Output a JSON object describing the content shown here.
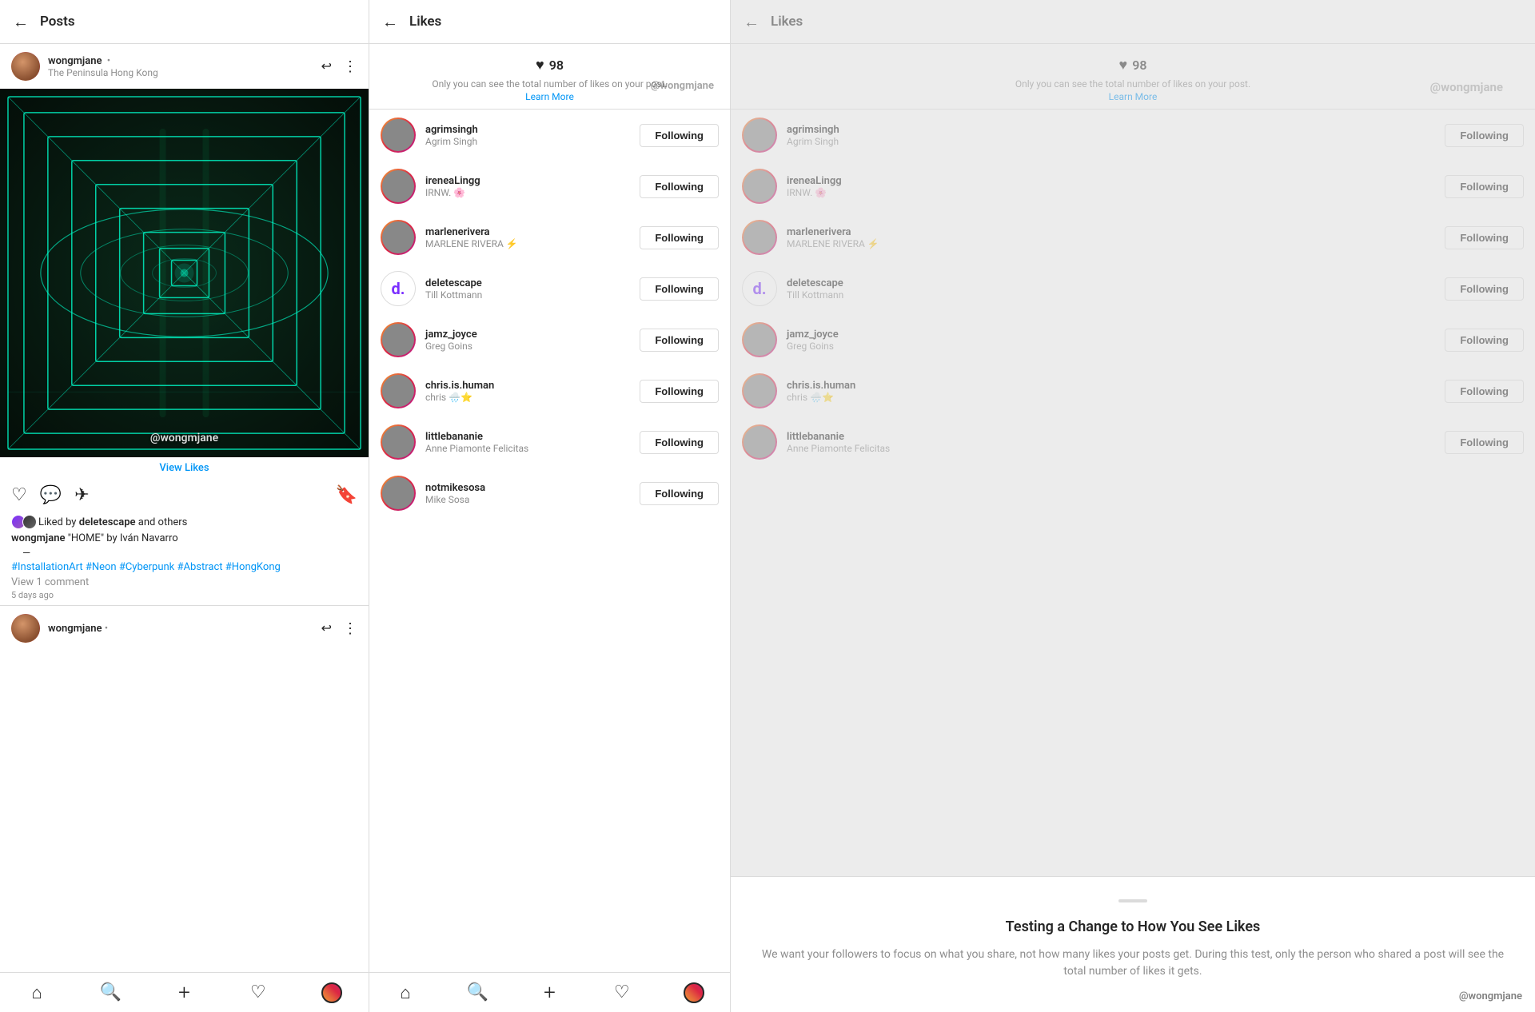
{
  "panel1": {
    "header": {
      "back_label": "←",
      "title": "Posts"
    },
    "post": {
      "username": "wongmjane",
      "dot": "•",
      "location": "The Peninsula Hong Kong",
      "image_watermark": "@wongmjane",
      "view_likes": "View Likes",
      "liked_by_text": "Liked by",
      "liked_by_bold": "deletescape",
      "liked_by_rest": "and others",
      "caption_user": "wongmjane",
      "caption_text": "\"HOME\" by Iván Navarro",
      "separator": "—",
      "hashtags": "#InstallationArt #Neon #Cyberpunk #Abstract #HongKong",
      "comments": "View 1 comment",
      "time": "5 days ago"
    },
    "nav": {
      "home": "⌂",
      "search": "🔍",
      "add": "+",
      "heart": "♡",
      "profile": ""
    }
  },
  "panel2": {
    "header": {
      "back_label": "←",
      "title": "Likes"
    },
    "likes_count": "98",
    "likes_note": "Only you can see the total number of likes on your post.",
    "learn_more": "Learn More",
    "watermark": "@wongmjane",
    "users": [
      {
        "handle": "agrimsingh",
        "fullname": "Agrim Singh",
        "following": "Following",
        "avatar_class": "av-brown"
      },
      {
        "handle": "ireneaLingg",
        "fullname": "IRNW. 🌸",
        "following": "Following",
        "avatar_class": "av-dark"
      },
      {
        "handle": "marlenerivera",
        "fullname": "MARLENE RIVERA ⚡",
        "following": "Following",
        "avatar_class": "av-photo3"
      },
      {
        "handle": "deletescape",
        "fullname": "Till Kottmann",
        "following": "Following",
        "avatar_class": "av-purple",
        "is_logo": true
      },
      {
        "handle": "jamz_joyce",
        "fullname": "Greg Goins",
        "following": "Following",
        "avatar_class": "av-photo4"
      },
      {
        "handle": "chris.is.human",
        "fullname": "chris 🌧️⭐",
        "following": "Following",
        "avatar_class": "av-photo6"
      },
      {
        "handle": "littlebananie",
        "fullname": "Anne Piamonte Felicitas",
        "following": "Following",
        "avatar_class": "av-photo7"
      },
      {
        "handle": "notmikesosa",
        "fullname": "Mike Sosa",
        "following": "Following",
        "avatar_class": "av-photo5"
      }
    ]
  },
  "panel3": {
    "header": {
      "back_label": "←",
      "title": "Likes"
    },
    "likes_count": "98",
    "likes_note": "Only you can see the total number of likes on your post.",
    "learn_more": "Learn More",
    "watermark": "@wongmjane",
    "users": [
      {
        "handle": "agrimsingh",
        "fullname": "Agrim Singh",
        "following": "Following",
        "avatar_class": "av-brown"
      },
      {
        "handle": "ireneaLingg",
        "fullname": "IRNW. 🌸",
        "following": "Following",
        "avatar_class": "av-dark"
      },
      {
        "handle": "marlenerivera",
        "fullname": "MARLENE RIVERA ⚡",
        "following": "Following",
        "avatar_class": "av-photo3"
      },
      {
        "handle": "deletescape",
        "fullname": "Till Kottmann",
        "following": "Following",
        "avatar_class": "av-purple",
        "is_logo": true
      },
      {
        "handle": "jamz_joyce",
        "fullname": "Greg Goins",
        "following": "Following",
        "avatar_class": "av-photo4"
      },
      {
        "handle": "chris.is.human",
        "fullname": "chris 🌧️⭐",
        "following": "Following",
        "avatar_class": "av-photo6"
      },
      {
        "handle": "littlebananie",
        "fullname": "Anne Piamonte Felicitas",
        "following": "Following",
        "avatar_class": "av-photo7"
      }
    ],
    "modal": {
      "title": "Testing a Change to How You See Likes",
      "body": "We want your followers to focus on what you share, not how many likes your posts get. During this test, only the person who shared a post will see the total number of likes it gets.",
      "watermark": "@wongmjane"
    }
  }
}
